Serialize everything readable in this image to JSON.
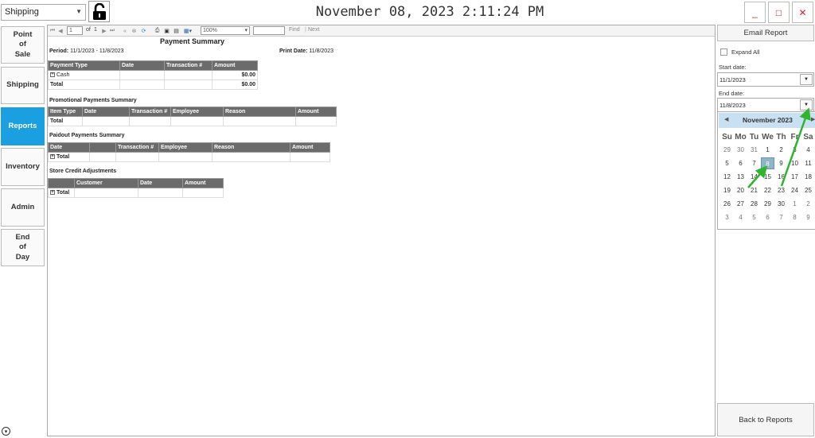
{
  "header": {
    "mode_value": "Shipping",
    "clock": "November 08, 2023 2:11:24 PM",
    "minimize_label": "_",
    "maximize_label": "□",
    "close_label": "✕"
  },
  "nav": {
    "items": [
      {
        "label": "Point\nof\nSale"
      },
      {
        "label": "Shipping"
      },
      {
        "label": "Reports"
      },
      {
        "label": "Inventory"
      },
      {
        "label": "Admin"
      },
      {
        "label": "End\nof\nDay"
      }
    ],
    "active": "Reports"
  },
  "viewer_toolbar": {
    "page_value": "1",
    "page_of": "of",
    "page_total": "1",
    "zoom_value": "100%",
    "find_label": "Find",
    "next_label": "Next"
  },
  "report": {
    "title": "Payment Summary",
    "period_label": "Period:",
    "period_value": "11/1/2023 - 11/8/2023",
    "print_date_label": "Print Date:",
    "print_date_value": "11/8/2023",
    "payment_table": {
      "headers": [
        "Payment Type",
        "Date",
        "Transaction #",
        "Amount"
      ],
      "rows": [
        {
          "type": "Cash",
          "amount": "$0.00"
        },
        {
          "type": "Total",
          "amount": "$0.00"
        }
      ]
    },
    "promo_title": "Promotional Payments Summary",
    "promo_table": {
      "headers": [
        "Item Type",
        "Date",
        "Transaction #",
        "Employee",
        "Reason",
        "Amount"
      ],
      "total_label": "Total"
    },
    "paidout_title": "Paidout Payments Summary",
    "paidout_table": {
      "headers": [
        "Date",
        "",
        "Transaction #",
        "Employee",
        "Reason",
        "Amount"
      ],
      "total_label": "Total"
    },
    "credit_title": "Store Credit Adjustments",
    "credit_table": {
      "headers": [
        "",
        "Customer",
        "Date",
        "Amount"
      ],
      "total_label": "Total"
    }
  },
  "right_panel": {
    "email_label": "Email Report",
    "expand_all_label": "Expand All",
    "start_date_label": "Start date:",
    "start_date_value": "11/1/2023",
    "end_date_label": "End date:",
    "end_date_value": "11/8/2023",
    "back_label": "Back to Reports"
  },
  "calendar": {
    "title": "November 2023",
    "weekdays": [
      "Su",
      "Mo",
      "Tu",
      "We",
      "Th",
      "Fr",
      "Sa"
    ],
    "weeks": [
      [
        "29",
        "30",
        "31",
        "1",
        "2",
        "3",
        "4"
      ],
      [
        "5",
        "6",
        "7",
        "8",
        "9",
        "10",
        "11"
      ],
      [
        "12",
        "13",
        "14",
        "15",
        "16",
        "17",
        "18"
      ],
      [
        "19",
        "20",
        "21",
        "22",
        "23",
        "24",
        "25"
      ],
      [
        "26",
        "27",
        "28",
        "29",
        "30",
        "1",
        "2"
      ],
      [
        "3",
        "4",
        "5",
        "6",
        "7",
        "8",
        "9"
      ]
    ],
    "selected_day": "8",
    "annotation_color": "#2db52d"
  }
}
